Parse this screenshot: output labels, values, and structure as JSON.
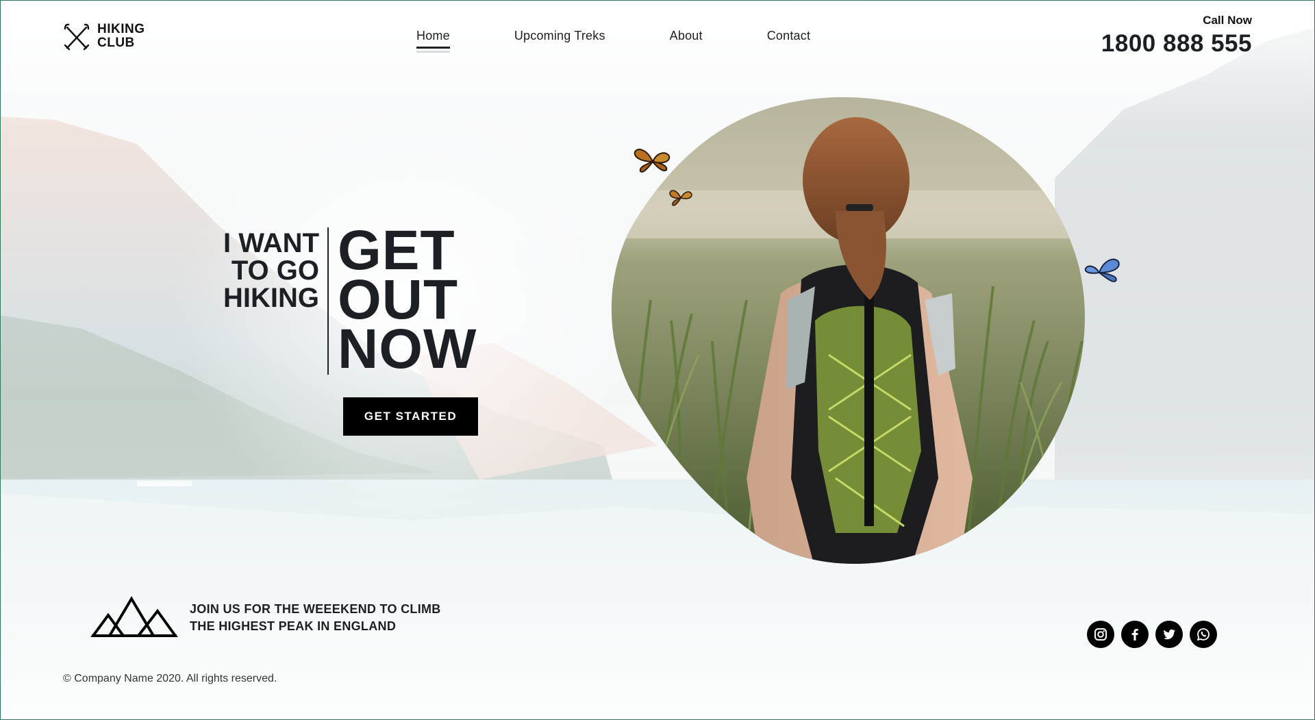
{
  "brand": {
    "line1": "HIKING",
    "line2": "CLUB",
    "icon": "crossed-trekking-poles-icon"
  },
  "nav": {
    "items": [
      {
        "label": "Home",
        "active": true
      },
      {
        "label": "Upcoming Treks",
        "active": false
      },
      {
        "label": "About",
        "active": false
      },
      {
        "label": "Contact",
        "active": false
      }
    ]
  },
  "call": {
    "label": "Call Now",
    "number": "1800 888 555"
  },
  "hero": {
    "small": [
      "I WANT",
      "TO GO",
      "HIKING"
    ],
    "big": [
      "GET",
      "OUT",
      "NOW"
    ],
    "cta": "GET STARTED"
  },
  "footer": {
    "icon": "mountains-icon",
    "tagline": [
      "JOIN US FOR THE WEEEKEND TO CLIMB",
      "THE HIGHEST PEAK IN ENGLAND"
    ],
    "copyright": "© Company Name 2020. All rights reserved."
  },
  "social": [
    {
      "name": "instagram-icon"
    },
    {
      "name": "facebook-icon"
    },
    {
      "name": "twitter-icon"
    },
    {
      "name": "whatsapp-icon"
    }
  ],
  "colors": {
    "text": "#1c1f23",
    "button_bg": "#000000",
    "button_text": "#ffffff",
    "frame": "#2a7a5a"
  }
}
